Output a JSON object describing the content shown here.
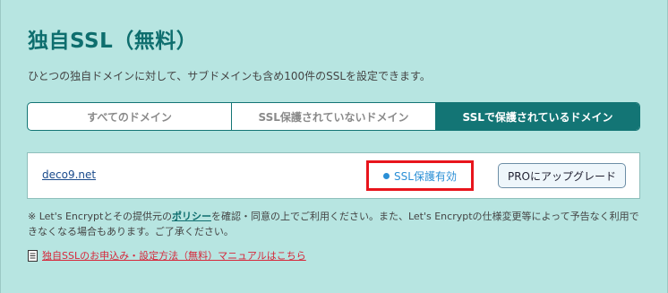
{
  "title": "独自SSL（無料）",
  "description": "ひとつの独自ドメインに対して、サブドメインも含め100件のSSLを設定できます。",
  "tabs": [
    {
      "label": "すべてのドメイン"
    },
    {
      "label": "SSL保護されていないドメイン"
    },
    {
      "label": "SSLで保護されているドメイン"
    }
  ],
  "domain": {
    "name": "deco9.net",
    "status": "SSL保護有効",
    "upgrade_button": "PROにアップグレード"
  },
  "note": {
    "prefix": "※ Let's Encryptとその提供元の",
    "policy_link": "ポリシー",
    "suffix": "を確認・同意の上でご利用ください。また、Let's Encryptの仕様変更等によって予告なく利用できなくなる場合もあります。ご了承ください。"
  },
  "manual_link": "独自SSLのお申込み・設定方法（無料）マニュアルはこちら",
  "colors": {
    "accent": "#137575",
    "status": "#2b8fd6",
    "highlight": "#e8141c",
    "link_red": "#d6283b"
  }
}
